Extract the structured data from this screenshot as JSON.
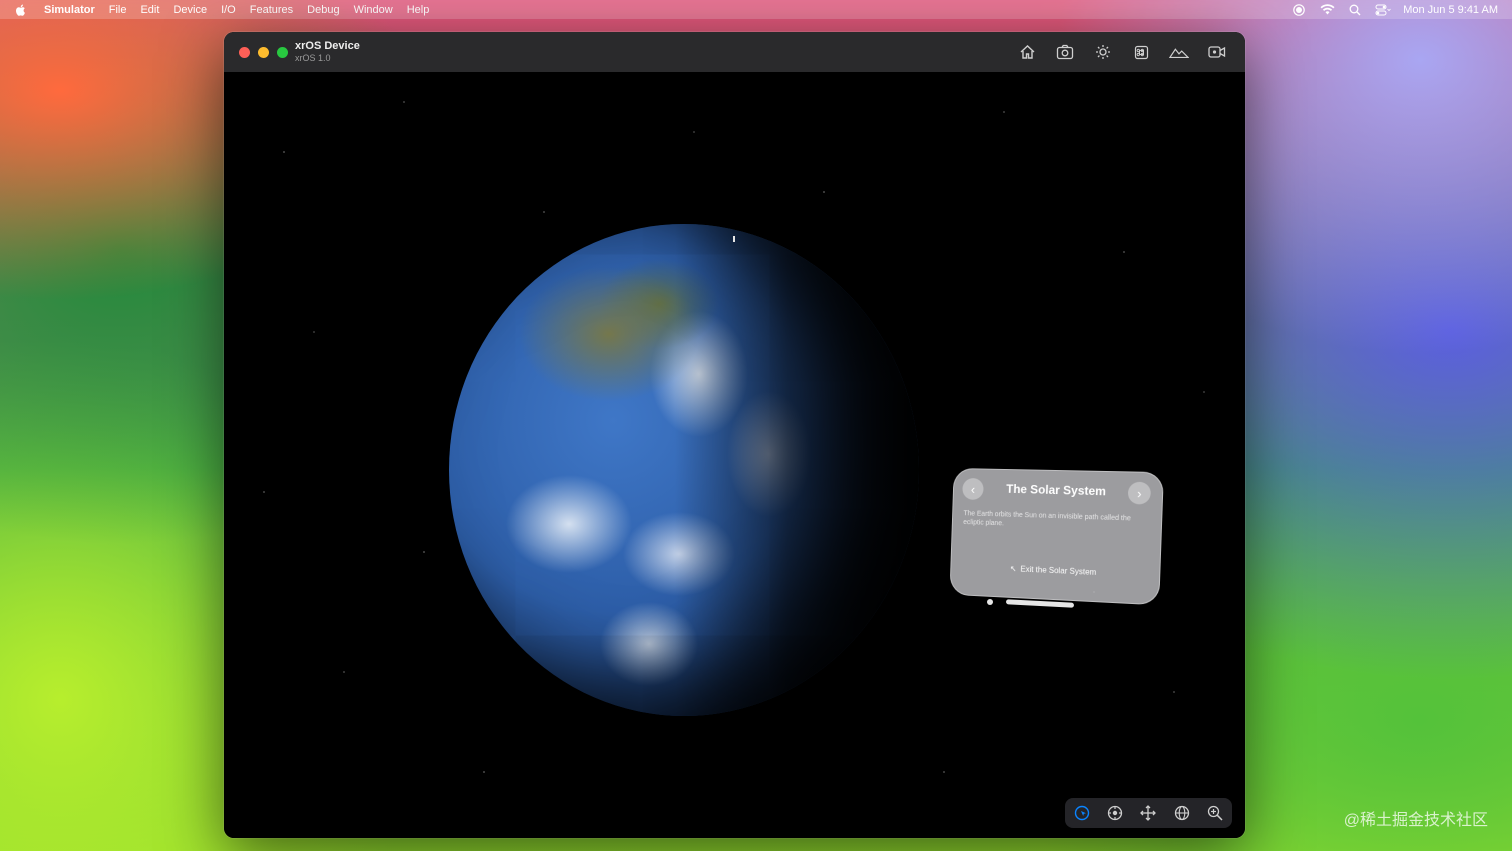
{
  "menubar": {
    "app_name": "Simulator",
    "items": [
      "File",
      "Edit",
      "Device",
      "I/O",
      "Features",
      "Debug",
      "Window",
      "Help"
    ],
    "clock": "Mon Jun 5  9:41 AM"
  },
  "window": {
    "title": "xrOS Device",
    "subtitle": "xrOS 1.0",
    "toolbar": [
      "home-icon",
      "screenshot-icon",
      "brightness-icon",
      "keyboard-command-icon",
      "environment-icon",
      "video-record-icon"
    ]
  },
  "panel": {
    "title": "The Solar System",
    "body": "The Earth orbits the Sun on an invisible path called the ecliptic plane.",
    "exit_label": "Exit the Solar System",
    "back_glyph": "‹",
    "next_glyph": "›",
    "exit_glyph": "↖"
  },
  "bottom_controls": [
    "interact-icon",
    "look-icon",
    "pan-icon",
    "orbit-icon",
    "zoom-icon"
  ],
  "watermark": "@稀土掘金技术社区",
  "colors": {
    "accent": "#0a84ff",
    "close": "#ff5f57",
    "minimize": "#febc2e",
    "zoom": "#28c840"
  }
}
